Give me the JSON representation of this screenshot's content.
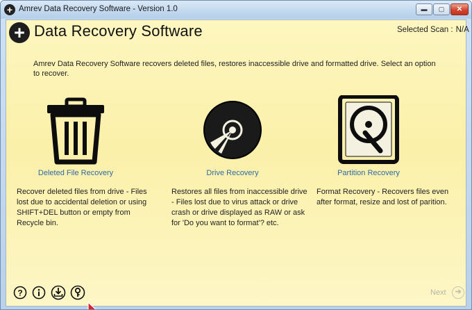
{
  "window": {
    "title": "Amrev Data Recovery Software - Version 1.0",
    "minimize_glyph": "▬",
    "maximize_glyph": "▢",
    "close_glyph": "✕"
  },
  "header": {
    "logo_glyph": "+",
    "title": "Data Recovery Software",
    "selected_scan_label": "Selected Scan :",
    "selected_scan_value": "N/A"
  },
  "intro": "Amrev Data Recovery Software recovers deleted files, restores inaccessible drive and formatted drive. Select an option to recover.",
  "options": [
    {
      "icon": "trash-icon",
      "label": "Deleted File Recovery",
      "description": "Recover deleted files from drive - Files lost due to accidental deletion or using SHIFT+DEL button or empty from Recycle bin."
    },
    {
      "icon": "disc-icon",
      "label": "Drive Recovery",
      "description": "Restores all files from inaccessible drive - Files lost due to virus attack or drive crash or drive displayed as RAW or ask for 'Do you want to format'? etc."
    },
    {
      "icon": "hard-drive-icon",
      "label": "Partition Recovery",
      "description": "Format Recovery - Recovers files even after format, resize and lost of parition."
    }
  ],
  "footer": {
    "icons": [
      "help-icon",
      "info-icon",
      "download-icon",
      "key-icon"
    ],
    "next_label": "Next",
    "next_glyph": "➔"
  },
  "colors": {
    "background": "#fbf0a9",
    "link": "#2f6aa5",
    "disabled": "#b5b5a5"
  }
}
